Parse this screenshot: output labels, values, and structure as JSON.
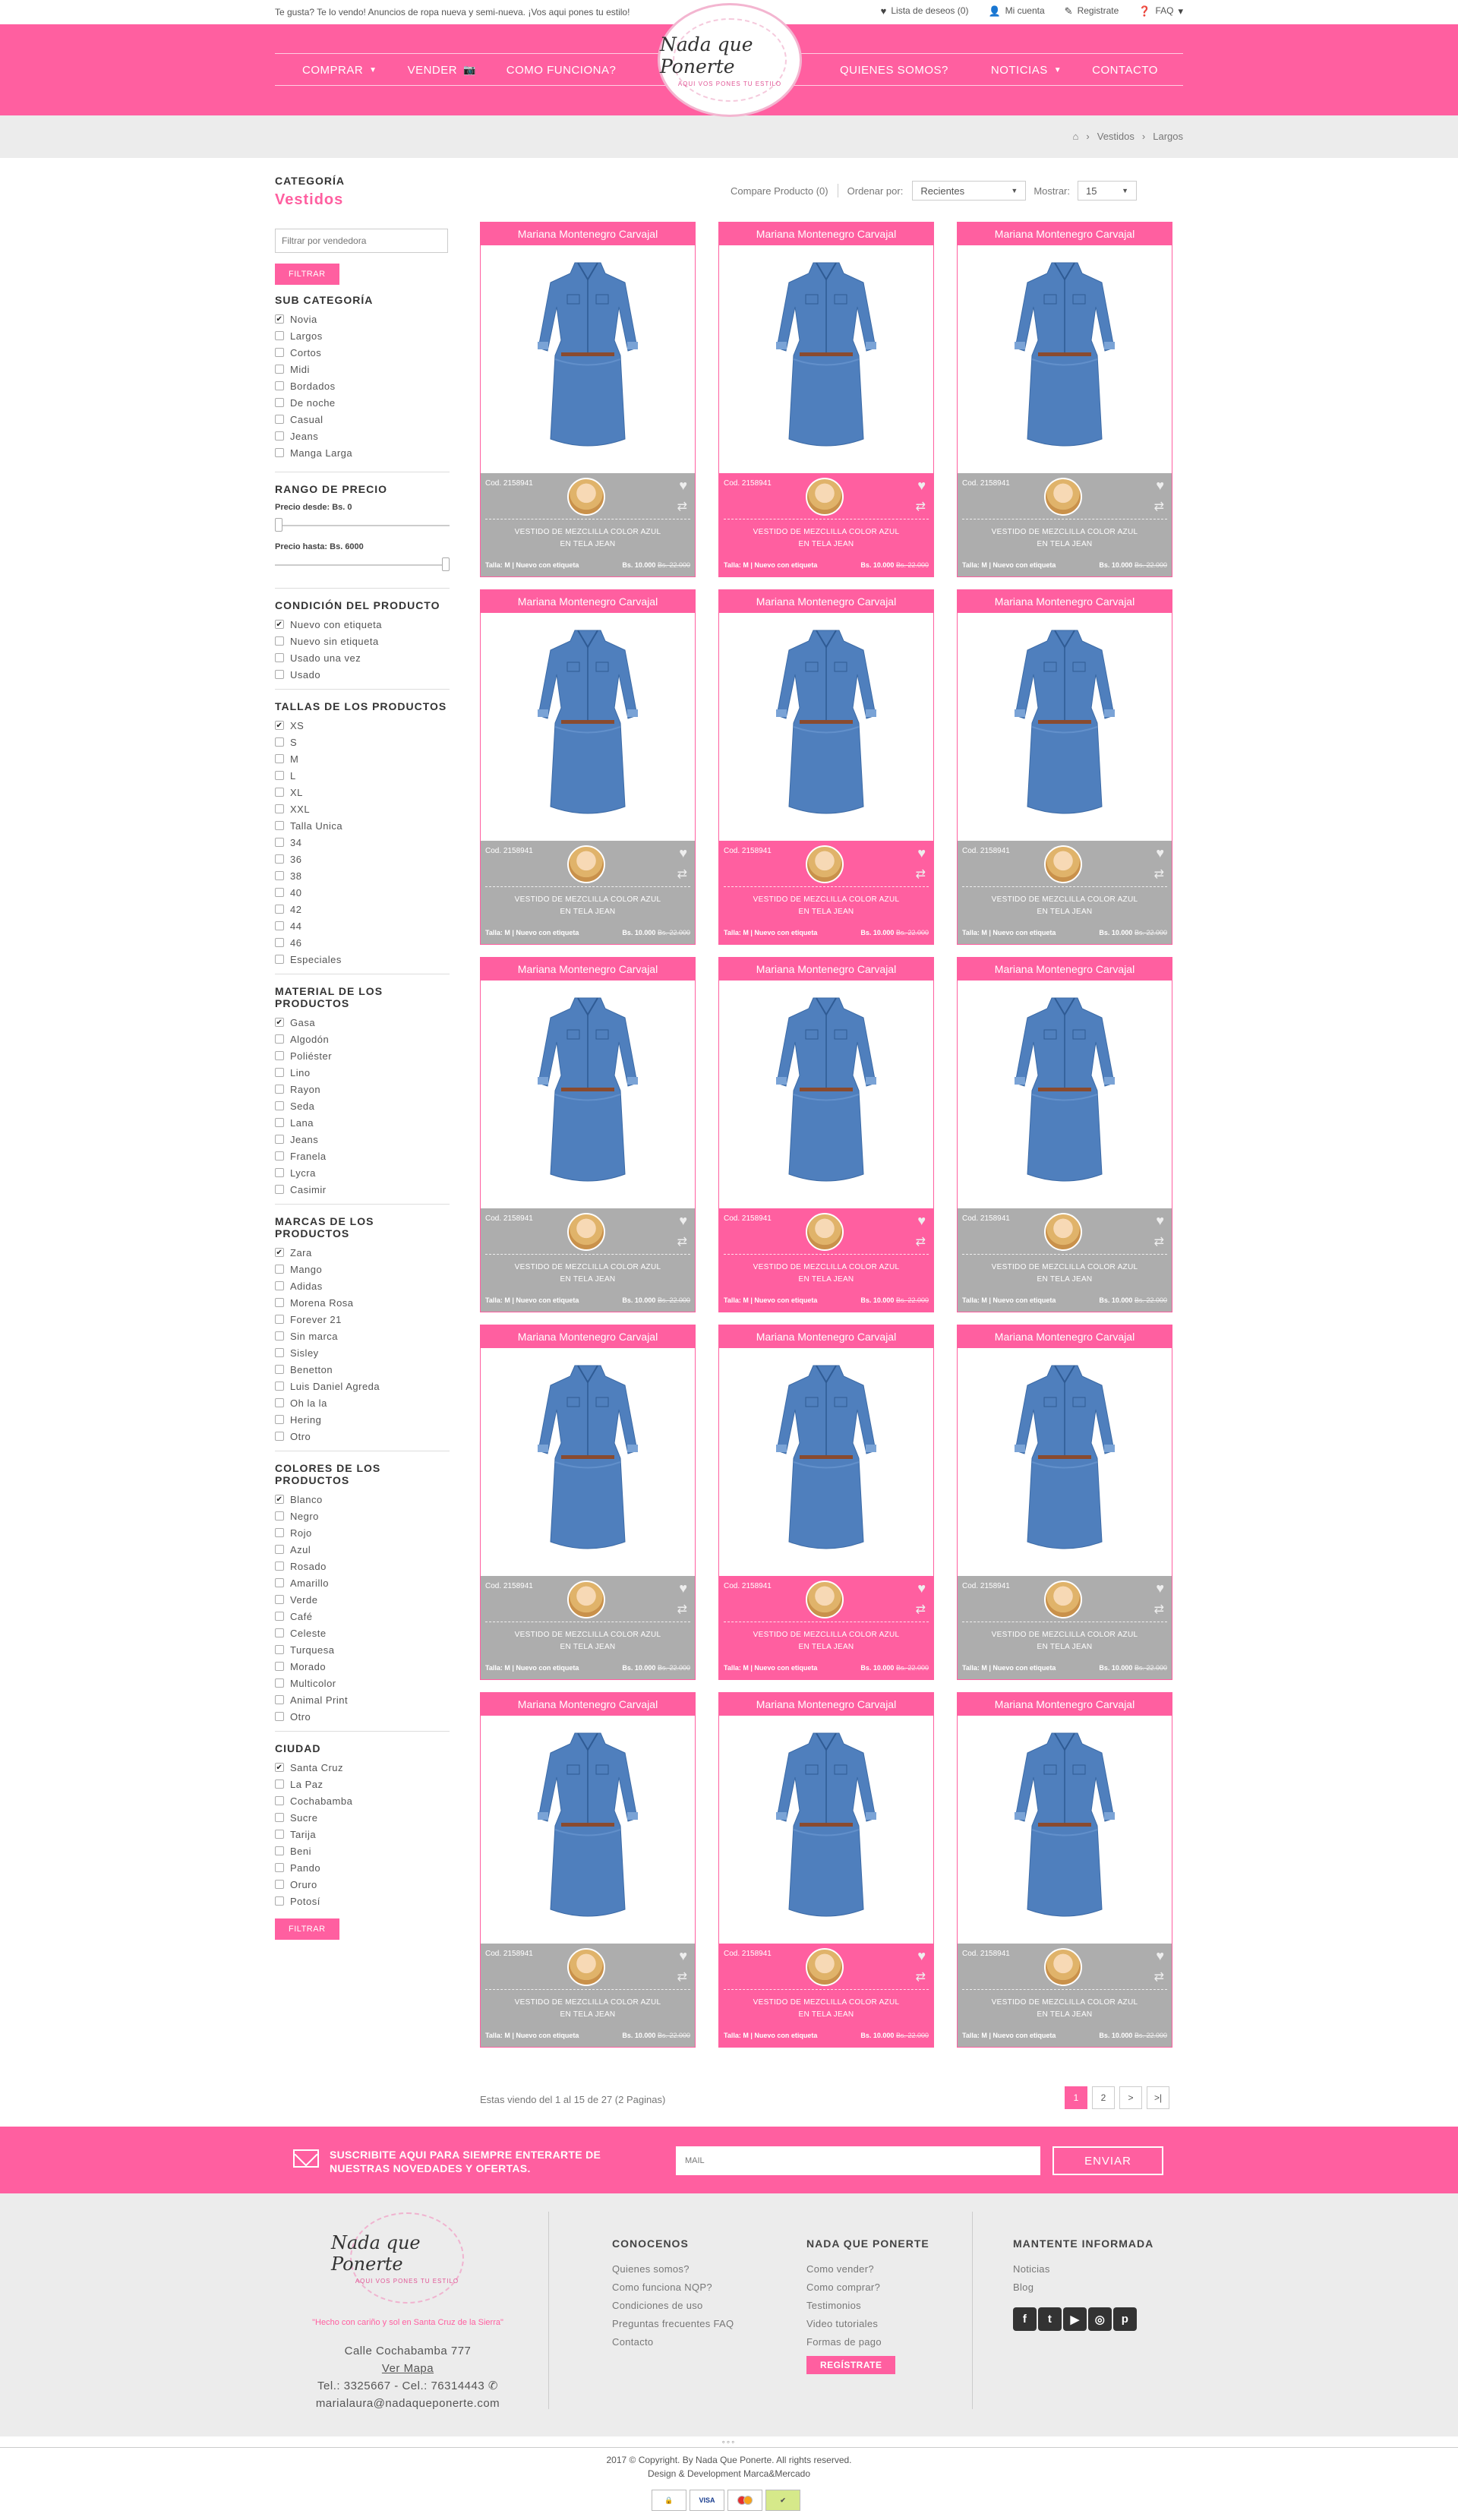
{
  "topbar": {
    "tagline": "Te gusta? Te lo vendo! Anuncios de ropa nueva y semi-nueva. ¡Vos aqui pones tu estilo!",
    "wishlist": "Lista de deseos (0)",
    "account": "Mi cuenta",
    "register": "Registrate",
    "faq": "FAQ"
  },
  "nav": {
    "left": [
      "COMPRAR",
      "VENDER",
      "COMO FUNCIONA?"
    ],
    "right": [
      "QUIENES SOMOS?",
      "NOTICIAS",
      "CONTACTO"
    ]
  },
  "logo": {
    "name": "Nada que Ponerte",
    "slogan": "AQUI VOS PONES TU ESTILO"
  },
  "breadcrumb": [
    "Vestidos",
    "Largos"
  ],
  "sidebar": {
    "category_heading": "CATEGORÍA",
    "category": "Vestidos",
    "seller_placeholder": "Filtrar por vendedora",
    "filter_button": "FILTRAR",
    "subcategory_heading": "SUB CATEGORÍA",
    "subcategories": [
      {
        "label": "Novia",
        "checked": true
      },
      {
        "label": "Largos",
        "checked": false
      },
      {
        "label": "Cortos",
        "checked": false
      },
      {
        "label": "Midi",
        "checked": false
      },
      {
        "label": "Bordados",
        "checked": false
      },
      {
        "label": "De noche",
        "checked": false
      },
      {
        "label": "Casual",
        "checked": false
      },
      {
        "label": "Jeans",
        "checked": false
      },
      {
        "label": "Manga Larga",
        "checked": false
      }
    ],
    "price_heading": "RANGO DE PRECIO",
    "price_from": "Precio desde: Bs. 0",
    "price_to": "Precio hasta: Bs. 6000",
    "condition_heading": "CONDICIÓN DEL PRODUCTO",
    "conditions": [
      {
        "label": "Nuevo con etiqueta",
        "checked": true
      },
      {
        "label": "Nuevo sin etiqueta",
        "checked": false
      },
      {
        "label": "Usado una vez",
        "checked": false
      },
      {
        "label": "Usado",
        "checked": false
      }
    ],
    "sizes_heading": "TALLAS DE LOS PRODUCTOS",
    "sizes": [
      {
        "label": "XS",
        "checked": true
      },
      {
        "label": "S",
        "checked": false
      },
      {
        "label": "M",
        "checked": false
      },
      {
        "label": "L",
        "checked": false
      },
      {
        "label": "XL",
        "checked": false
      },
      {
        "label": "XXL",
        "checked": false
      },
      {
        "label": "Talla Unica",
        "checked": false
      },
      {
        "label": "34",
        "checked": false
      },
      {
        "label": "36",
        "checked": false
      },
      {
        "label": "38",
        "checked": false
      },
      {
        "label": "40",
        "checked": false
      },
      {
        "label": "42",
        "checked": false
      },
      {
        "label": "44",
        "checked": false
      },
      {
        "label": "46",
        "checked": false
      },
      {
        "label": "Especiales",
        "checked": false
      }
    ],
    "material_heading": "MATERIAL DE LOS PRODUCTOS",
    "materials": [
      {
        "label": "Gasa",
        "checked": true
      },
      {
        "label": "Algodón",
        "checked": false
      },
      {
        "label": "Poliéster",
        "checked": false
      },
      {
        "label": "Lino",
        "checked": false
      },
      {
        "label": "Rayon",
        "checked": false
      },
      {
        "label": "Seda",
        "checked": false
      },
      {
        "label": "Lana",
        "checked": false
      },
      {
        "label": "Jeans",
        "checked": false
      },
      {
        "label": "Franela",
        "checked": false
      },
      {
        "label": "Lycra",
        "checked": false
      },
      {
        "label": "Casimir",
        "checked": false
      }
    ],
    "brands_heading": "MARCAS DE LOS PRODUCTOS",
    "brands": [
      {
        "label": "Zara",
        "checked": true
      },
      {
        "label": "Mango",
        "checked": false
      },
      {
        "label": "Adidas",
        "checked": false
      },
      {
        "label": "Morena Rosa",
        "checked": false
      },
      {
        "label": "Forever 21",
        "checked": false
      },
      {
        "label": "Sin marca",
        "checked": false
      },
      {
        "label": "Sisley",
        "checked": false
      },
      {
        "label": "Benetton",
        "checked": false
      },
      {
        "label": "Luis Daniel Agreda",
        "checked": false
      },
      {
        "label": "Oh la la",
        "checked": false
      },
      {
        "label": "Hering",
        "checked": false
      },
      {
        "label": "Otro",
        "checked": false
      }
    ],
    "colors_heading": "COLORES DE LOS PRODUCTOS",
    "colors": [
      {
        "label": "Blanco",
        "checked": true
      },
      {
        "label": "Negro",
        "checked": false
      },
      {
        "label": "Rojo",
        "checked": false
      },
      {
        "label": "Azul",
        "checked": false
      },
      {
        "label": "Rosado",
        "checked": false
      },
      {
        "label": "Amarillo",
        "checked": false
      },
      {
        "label": "Verde",
        "checked": false
      },
      {
        "label": "Café",
        "checked": false
      },
      {
        "label": "Celeste",
        "checked": false
      },
      {
        "label": "Turquesa",
        "checked": false
      },
      {
        "label": "Morado",
        "checked": false
      },
      {
        "label": "Multicolor",
        "checked": false
      },
      {
        "label": "Animal Print",
        "checked": false
      },
      {
        "label": "Otro",
        "checked": false
      }
    ],
    "city_heading": "CIUDAD",
    "cities": [
      {
        "label": "Santa Cruz",
        "checked": true
      },
      {
        "label": "La Paz",
        "checked": false
      },
      {
        "label": "Cochabamba",
        "checked": false
      },
      {
        "label": "Sucre",
        "checked": false
      },
      {
        "label": "Tarija",
        "checked": false
      },
      {
        "label": "Beni",
        "checked": false
      },
      {
        "label": "Pando",
        "checked": false
      },
      {
        "label": "Oruro",
        "checked": false
      },
      {
        "label": "Potosí",
        "checked": false
      }
    ]
  },
  "toolbar": {
    "compare": "Compare Producto (0)",
    "sort_label": "Ordenar por:",
    "sort_value": "Recientes",
    "show_label": "Mostrar:",
    "show_value": "15"
  },
  "product": {
    "seller": "Mariana Montenegro Carvajal",
    "code": "Cod. 2158941",
    "title": "VESTIDO DE MEZCLILLA COLOR AZUL EN TELA JEAN",
    "size": "Talla: M",
    "condition": "Nuevo con etiqueta",
    "price": "Bs. 10.000",
    "old_price": "Bs. 22.000"
  },
  "product_count": 15,
  "pagination": {
    "summary": "Estas viendo del 1 al 15 de 27 (2 Paginas)",
    "pages": [
      "1",
      "2",
      ">",
      ">|"
    ]
  },
  "newsletter": {
    "text": "SUSCRIBITE AQUI PARA SIEMPRE ENTERARTE DE NUESTRAS NOVEDADES Y OFERTAS.",
    "placeholder": "MAIL",
    "button": "ENVIAR"
  },
  "footer": {
    "made": "\"Hecho con cariño y sol en Santa Cruz de la Sierra\"",
    "address": "Calle Cochabamba 777",
    "map": "Ver Mapa",
    "phone": "Tel.: 3325667  -  Cel.: 76314443",
    "email": "marialaura@nadaqueponerte.com",
    "col1": {
      "heading": "CONOCENOS",
      "links": [
        "Quienes somos?",
        "Como funciona NQP?",
        "Condiciones de uso",
        "Preguntas frecuentes FAQ",
        "Contacto"
      ]
    },
    "col2": {
      "heading": "NADA QUE PONERTE",
      "links": [
        "Como vender?",
        "Como comprar?",
        "Testimonios",
        "Video tutoriales",
        "Formas de pago"
      ],
      "button": "REGÍSTRATE"
    },
    "col3": {
      "heading": "MANTENTE INFORMADA",
      "links": [
        "Noticias",
        "Blog"
      ]
    },
    "copyright": "2017 © Copyright. By Nada Que Ponerte. All rights reserved.",
    "dev": "Design & Development Marca&Mercado",
    "payments": [
      "VISA",
      "MC"
    ]
  },
  "colors": {
    "accent": "#ff5fa0",
    "card_gray": "#adadad",
    "denim": "#4f7fbd"
  }
}
